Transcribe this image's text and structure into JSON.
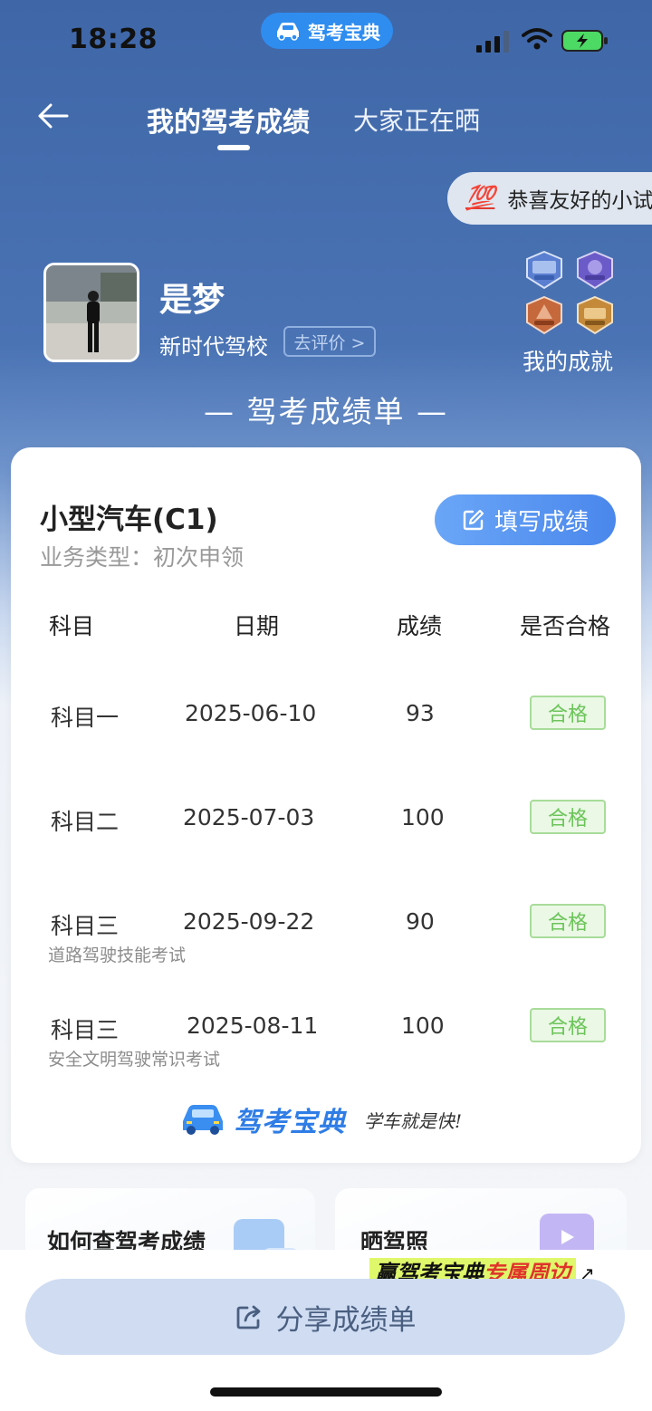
{
  "status_bar": {
    "time": "18:28",
    "app_name": "驾考宝典"
  },
  "nav": {
    "tab_active": "我的驾考成绩",
    "tab_other": "大家正在晒"
  },
  "congrats": {
    "icon": "💯",
    "text": "恭喜友好的小试"
  },
  "profile": {
    "name": "是梦",
    "school": "新时代驾校",
    "review_label": "去评价 >",
    "achievement_label": "我的成就"
  },
  "section_title": "— 驾考成绩单 —",
  "card": {
    "car_type": "小型汽车(C1)",
    "business_type": "业务类型：初次申领",
    "fill_button": "填写成绩",
    "headers": [
      "科目",
      "日期",
      "成绩",
      "是否合格"
    ],
    "rows": [
      {
        "subject": "科目一",
        "date": "2025-06-10",
        "score": "93",
        "status": "合格",
        "note": ""
      },
      {
        "subject": "科目二",
        "date": "2025-07-03",
        "score": "100",
        "status": "合格",
        "note": ""
      },
      {
        "subject": "科目三",
        "date": "2025-09-22",
        "score": "90",
        "status": "合格",
        "note": "道路驾驶技能考试"
      },
      {
        "subject": "科目三",
        "date": "2025-08-11",
        "score": "100",
        "status": "合格",
        "note": "安全文明驾驶常识考试"
      }
    ],
    "brand_name": "驾考宝典",
    "brand_slogan": "学车就是快!"
  },
  "bottom_cards": [
    {
      "title": "如何查驾考成绩"
    },
    {
      "title": "晒驾照"
    }
  ],
  "promo": {
    "prefix": "赢驾考宝典",
    "highlight": "专属周边",
    "suffix": "↗"
  },
  "share_button": "分享成绩单",
  "colors": {
    "primary_blue": "#4a73b4",
    "button_blue": "#4a87ec",
    "pass_green": "#6cc45a"
  }
}
